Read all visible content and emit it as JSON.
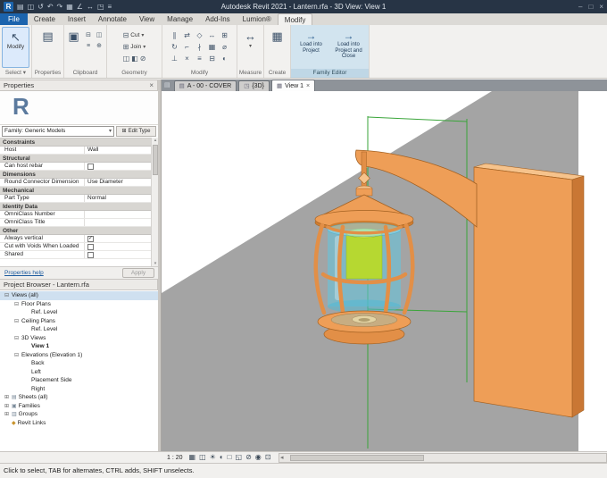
{
  "title_bar": {
    "title": "Autodesk Revit 2021 - Lantern.rfa - 3D View: View 1",
    "logo_letter": "R",
    "qat": [
      {
        "name": "open-file-icon",
        "glyph": "▤"
      },
      {
        "name": "save-icon",
        "glyph": "◫"
      },
      {
        "name": "sync-icon",
        "glyph": "↺"
      },
      {
        "name": "undo-icon",
        "glyph": "↶"
      },
      {
        "name": "redo-icon",
        "glyph": "↷"
      },
      {
        "name": "print-icon",
        "glyph": "▦"
      },
      {
        "name": "measure-icon",
        "glyph": "∠"
      },
      {
        "name": "aligned-dimension-icon",
        "glyph": "↔"
      },
      {
        "name": "default-3d-view-icon",
        "glyph": "◳"
      },
      {
        "name": "thin-lines-icon",
        "glyph": "≡"
      }
    ],
    "window_buttons": [
      {
        "name": "minimize-button",
        "glyph": "–"
      },
      {
        "name": "maximize-button",
        "glyph": "□"
      },
      {
        "name": "close-button",
        "glyph": "×"
      }
    ]
  },
  "ribbon": {
    "tabs": [
      {
        "label": "File",
        "style": "file"
      },
      {
        "label": "Create"
      },
      {
        "label": "Insert"
      },
      {
        "label": "Annotate"
      },
      {
        "label": "View"
      },
      {
        "label": "Manage"
      },
      {
        "label": "Add-Ins"
      },
      {
        "label": "Lumion®"
      },
      {
        "label": "Modify",
        "style": "active"
      }
    ],
    "panels": [
      "Select ▾",
      "Properties",
      "Clipboard",
      "Geometry",
      "Modify",
      "Measure",
      "Create",
      "Family Editor"
    ],
    "modify_button": "Modify",
    "geometry": {
      "cut_label": "Cut",
      "join_label": "Join"
    },
    "geometry_tools": [
      {
        "name": "cut-profile-icon",
        "glyph": "◫"
      },
      {
        "name": "paint-icon",
        "glyph": "◧"
      },
      {
        "name": "demolish-icon",
        "glyph": "⊘"
      }
    ],
    "clipboard_tools": [
      {
        "name": "cut-to-clipboard-icon",
        "glyph": "⊟"
      },
      {
        "name": "copy-to-clipboard-icon",
        "glyph": "◫"
      },
      {
        "name": "match-type-icon",
        "glyph": "≡"
      },
      {
        "name": "paste-aligned-icon",
        "glyph": "⊕"
      }
    ],
    "modify_tools": [
      {
        "name": "align-tool-icon",
        "glyph": "∥"
      },
      {
        "name": "offset-tool-icon",
        "glyph": "⇄"
      },
      {
        "name": "mirror-tool-icon",
        "glyph": "◇"
      },
      {
        "name": "move-tool-icon",
        "glyph": "↔"
      },
      {
        "name": "copy-tool-icon",
        "glyph": "⊞"
      },
      {
        "name": "rotate-tool-icon",
        "glyph": "↻"
      },
      {
        "name": "trim-tool-icon",
        "glyph": "⌐"
      },
      {
        "name": "split-tool-icon",
        "glyph": "∤"
      },
      {
        "name": "array-tool-icon",
        "glyph": "▦"
      },
      {
        "name": "scale-tool-icon",
        "glyph": "⌀"
      },
      {
        "name": "pin-tool-icon",
        "glyph": "⊥"
      },
      {
        "name": "delete-tool-icon",
        "glyph": "×"
      },
      {
        "name": "match-tool-icon",
        "glyph": "≡"
      },
      {
        "name": "cope-tool-icon",
        "glyph": "⊟"
      },
      {
        "name": "paint-tool-icon",
        "glyph": "◐"
      }
    ],
    "family_editor": {
      "load_label": "Load into Project",
      "load_close_label": "Load into Project and Close"
    }
  },
  "icons": {
    "cursor": "↖",
    "properties": "▤",
    "paste": "▣",
    "cut_geometry": "⊟",
    "join_geometry": "⊞",
    "measure": "↔",
    "create_group": "▦",
    "load": "→",
    "dropdown": "▾",
    "close": "×",
    "edit_type": "⊞",
    "sheet": "▤",
    "three_d": "◳",
    "view": "▦",
    "families": "▣",
    "groups": "▥",
    "revit_link": "◆",
    "scroll_up": "▴",
    "scroll_down": "▾",
    "scroll_left": "◂"
  },
  "properties_panel": {
    "header": "Properties",
    "preview_letter": "R",
    "type_selector": "Family: Generic Models",
    "edit_type": "Edit Type",
    "groups": [
      {
        "name": "Constraints",
        "rows": [
          {
            "label": "Host",
            "value": "Wall"
          }
        ]
      },
      {
        "name": "Structural",
        "rows": [
          {
            "label": "Can host rebar",
            "checkbox": false
          }
        ]
      },
      {
        "name": "Dimensions",
        "rows": [
          {
            "label": "Round Connector Dimension",
            "value": "Use Diameter"
          }
        ]
      },
      {
        "name": "Mechanical",
        "rows": [
          {
            "label": "Part Type",
            "value": "Normal"
          }
        ]
      },
      {
        "name": "Identity Data",
        "rows": [
          {
            "label": "OmniClass Number",
            "value": ""
          },
          {
            "label": "OmniClass Title",
            "value": ""
          }
        ]
      },
      {
        "name": "Other",
        "rows": [
          {
            "label": "Always vertical",
            "checkbox": true
          },
          {
            "label": "Cut with Voids When Loaded",
            "checkbox": false
          },
          {
            "label": "Shared",
            "checkbox": false
          }
        ]
      }
    ],
    "help_link": "Properties help",
    "apply_button": "Apply"
  },
  "project_browser": {
    "header": "Project Browser - Lantern.rfa",
    "tree": [
      {
        "label": "Views (all)",
        "depth": 0,
        "expander": "minus",
        "selected": true
      },
      {
        "label": "Floor Plans",
        "depth": 1,
        "expander": "minus"
      },
      {
        "label": "Ref. Level",
        "depth": 2
      },
      {
        "label": "Ceiling Plans",
        "depth": 1,
        "expander": "minus"
      },
      {
        "label": "Ref. Level",
        "depth": 2
      },
      {
        "label": "3D Views",
        "depth": 1,
        "expander": "minus"
      },
      {
        "label": "View 1",
        "depth": 2,
        "bold": true
      },
      {
        "label": "Elevations (Elevation 1)",
        "depth": 1,
        "expander": "minus"
      },
      {
        "label": "Back",
        "depth": 2
      },
      {
        "label": "Left",
        "depth": 2
      },
      {
        "label": "Placement Side",
        "depth": 2
      },
      {
        "label": "Right",
        "depth": 2
      },
      {
        "label": "Sheets (all)",
        "depth": 0,
        "expander": "plus",
        "icon": "sheet"
      },
      {
        "label": "Families",
        "depth": 0,
        "expander": "plus",
        "icon": "families"
      },
      {
        "label": "Groups",
        "depth": 0,
        "expander": "plus",
        "icon": "groups"
      },
      {
        "label": "Revit Links",
        "depth": 0,
        "icon": "revit_link"
      }
    ]
  },
  "view_tabs": [
    {
      "label": "A - 00 - COVER",
      "icon": "sheet",
      "active": false
    },
    {
      "label": "{3D}",
      "icon": "three_d",
      "active": false
    },
    {
      "label": "View 1",
      "icon": "view",
      "active": true
    }
  ],
  "view_control_bar": {
    "scale": "1 : 20",
    "icons": [
      {
        "name": "detail-level-icon",
        "glyph": "▦"
      },
      {
        "name": "visual-style-icon",
        "glyph": "◫"
      },
      {
        "name": "sun-settings-icon",
        "glyph": "☀"
      },
      {
        "name": "shadows-icon",
        "glyph": "◐"
      },
      {
        "name": "crop-view-icon",
        "glyph": "□"
      },
      {
        "name": "crop-region-visibility-icon",
        "glyph": "◱"
      },
      {
        "name": "temporary-hide-isolate-icon",
        "glyph": "⊘"
      },
      {
        "name": "reveal-hidden-elements-icon",
        "glyph": "◉"
      },
      {
        "name": "temporary-view-properties-icon",
        "glyph": "⊡"
      }
    ]
  },
  "status_bar": {
    "message": "Click to select, TAB for alternates, CTRL adds, SHIFT unselects."
  },
  "theme": {
    "titlebar_bg": "#273445",
    "file_tab_blue": "#1c64ad",
    "family_editor_bg": "#d2e4ef",
    "selection_blue": "#cfe0f0",
    "link_blue": "#1b5a9e"
  },
  "canvas": {
    "colors": {
      "background": "#ffffff",
      "wall_gray": "#a4a4a4",
      "ref_green": "#3aa53a",
      "orange_face": "#ee9e57",
      "orange_dark": "#cf7d30",
      "orange_side": "#c97734",
      "orange_light": "#f6c38c",
      "rib_orange": "#e28f47",
      "outline": "#a36122",
      "glass_blue": "rgba(96,198,224,0.55)",
      "glass_top": "rgba(140,220,238,0.55)",
      "glass_bottom": "rgba(80,185,214,0.55)",
      "glass_edge": "rgba(70,170,200,0.7)",
      "candle_green": "#b6d831",
      "candle_top": "#d3e95e",
      "candle_edge": "#93b822",
      "bowl_tan": "#c7ad82",
      "cup_tan": "#e4d4a4",
      "cup_inner": "#b2a070"
    }
  }
}
